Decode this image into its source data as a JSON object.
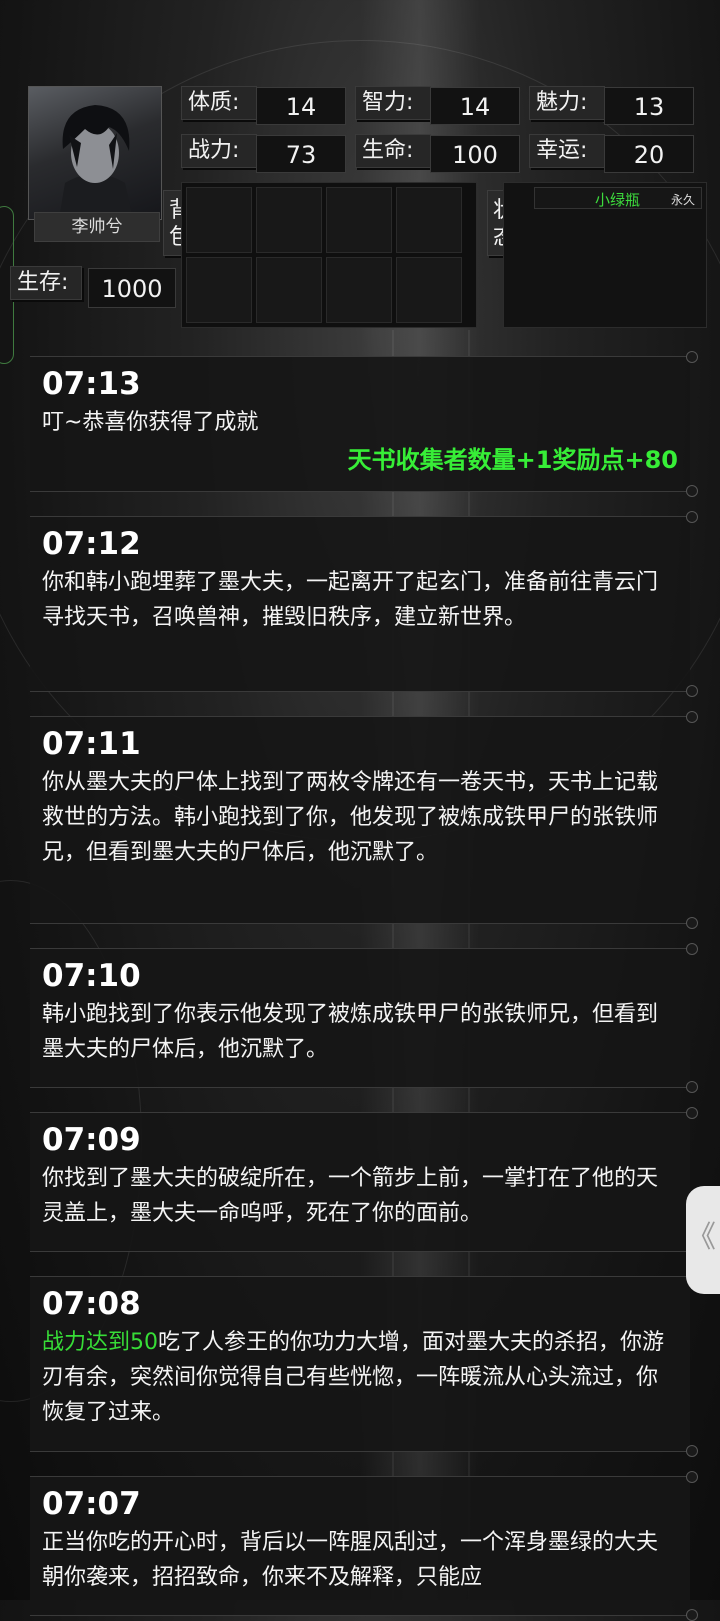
{
  "character": {
    "name": "李帅兮",
    "stats": [
      {
        "label": "体质:",
        "value": "14"
      },
      {
        "label": "智力:",
        "value": "14"
      },
      {
        "label": "魅力:",
        "value": "13"
      },
      {
        "label": "战力:",
        "value": "73"
      },
      {
        "label": "生命:",
        "value": "100"
      },
      {
        "label": "幸运:",
        "value": "20"
      }
    ],
    "survive_label": "生存:",
    "survive_value": "1000"
  },
  "tabs": {
    "bag": "背包",
    "status": "状态"
  },
  "status_effects": [
    {
      "name": "小绿瓶",
      "duration": "永久"
    }
  ],
  "colors": {
    "highlight_green": "#37dd37",
    "background": "#1a1a1a"
  },
  "logs": [
    {
      "time": "07:13",
      "text": "叮~恭喜你获得了成就",
      "reward": "天书收集者数量+1奖励点+80"
    },
    {
      "time": "07:12",
      "text": "你和韩小跑埋葬了墨大夫，一起离开了起玄门，准备前往青云门寻找天书，召唤兽神，摧毁旧秩序，建立新世界。"
    },
    {
      "time": "07:11",
      "text": "你从墨大夫的尸体上找到了两枚令牌还有一卷天书，天书上记载救世的方法。韩小跑找到了你，他发现了被炼成铁甲尸的张铁师兄，但看到墨大夫的尸体后，他沉默了。"
    },
    {
      "time": "07:10",
      "text": "韩小跑找到了你表示他发现了被炼成铁甲尸的张铁师兄，但看到墨大夫的尸体后，他沉默了。"
    },
    {
      "time": "07:09",
      "text": "你找到了墨大夫的破绽所在，一个箭步上前，一掌打在了他的天灵盖上，墨大夫一命呜呼，死在了你的面前。"
    },
    {
      "time": "07:08",
      "highlight": "战力达到50",
      "text": "吃了人参王的你功力大增，面对墨大夫的杀招，你游刃有余，突然间你觉得自己有些恍惚，一阵暖流从心头流过，你恢复了过来。"
    },
    {
      "time": "07:07",
      "text": "正当你吃的开心时，背后以一阵腥风刮过，一个浑身墨绿的大夫朝你袭来，招招致命，你来不及解释，只能应"
    }
  ],
  "side_tab_glyph": "《"
}
